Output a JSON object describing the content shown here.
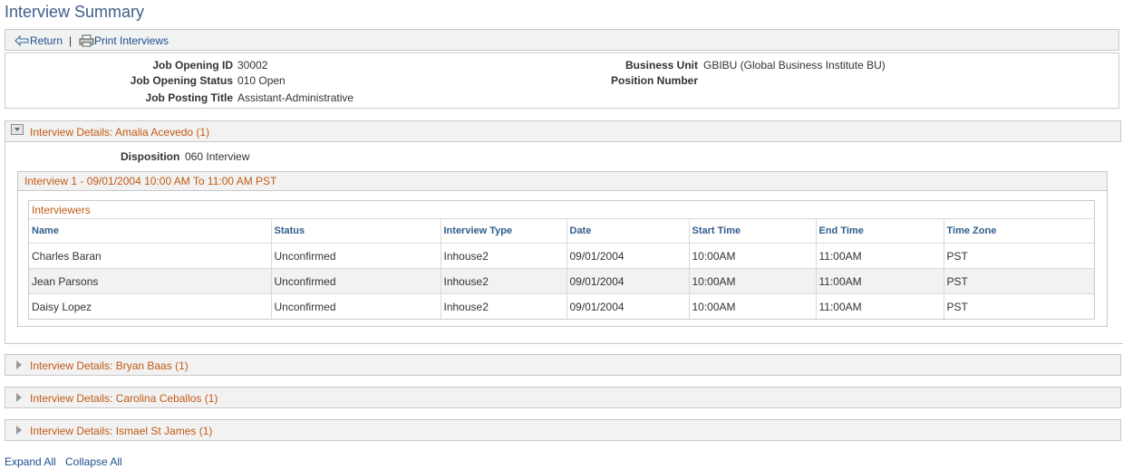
{
  "page_title": "Interview Summary",
  "toolbar": {
    "return_label": "Return",
    "separator": "|",
    "print_label": "Print Interviews"
  },
  "header": {
    "job_opening_id_label": "Job Opening ID",
    "job_opening_id": "30002",
    "job_opening_status_label": "Job Opening Status",
    "job_opening_status": "010 Open",
    "job_posting_title_label": "Job Posting Title",
    "job_posting_title": "Assistant-Administrative",
    "business_unit_label": "Business Unit",
    "business_unit": "GBIBU (Global Business Institute BU)",
    "position_number_label": "Position Number"
  },
  "sections": [
    {
      "title": "Interview Details: Amalia Acevedo (1)",
      "expanded": true
    },
    {
      "title": "Interview Details: Bryan Baas (1)",
      "expanded": false
    },
    {
      "title": "Interview Details: Carolina Ceballos (1)",
      "expanded": false
    },
    {
      "title": "Interview Details: Ismael St James (1)",
      "expanded": false
    }
  ],
  "expanded": {
    "disposition_label": "Disposition",
    "disposition": "060 Interview",
    "interview_title": "Interview 1 - 09/01/2004 10:00 AM To 11:00 AM PST",
    "grid_title": "Interviewers",
    "columns": [
      "Name",
      "Status",
      "Interview Type",
      "Date",
      "Start Time",
      "End Time",
      "Time Zone"
    ],
    "rows": [
      [
        "Charles Baran",
        "Unconfirmed",
        "Inhouse2",
        "09/01/2004",
        "10:00AM",
        "11:00AM",
        "PST"
      ],
      [
        "Jean Parsons",
        "Unconfirmed",
        "Inhouse2",
        "09/01/2004",
        "10:00AM",
        "11:00AM",
        "PST"
      ],
      [
        "Daisy Lopez",
        "Unconfirmed",
        "Inhouse2",
        "09/01/2004",
        "10:00AM",
        "11:00AM",
        "PST"
      ]
    ]
  },
  "footer": {
    "expand_all": "Expand All",
    "collapse_all": "Collapse All"
  },
  "icons": {
    "return": "return-arrow-icon",
    "print": "printer-icon",
    "expand": "collapse-toggle-icon",
    "collapsed": "triangle-right-icon"
  },
  "colors": {
    "title": "#3f5e8a",
    "section_title": "#c25a15",
    "link": "#1f4f8f",
    "column_header": "#2f5d8c"
  }
}
